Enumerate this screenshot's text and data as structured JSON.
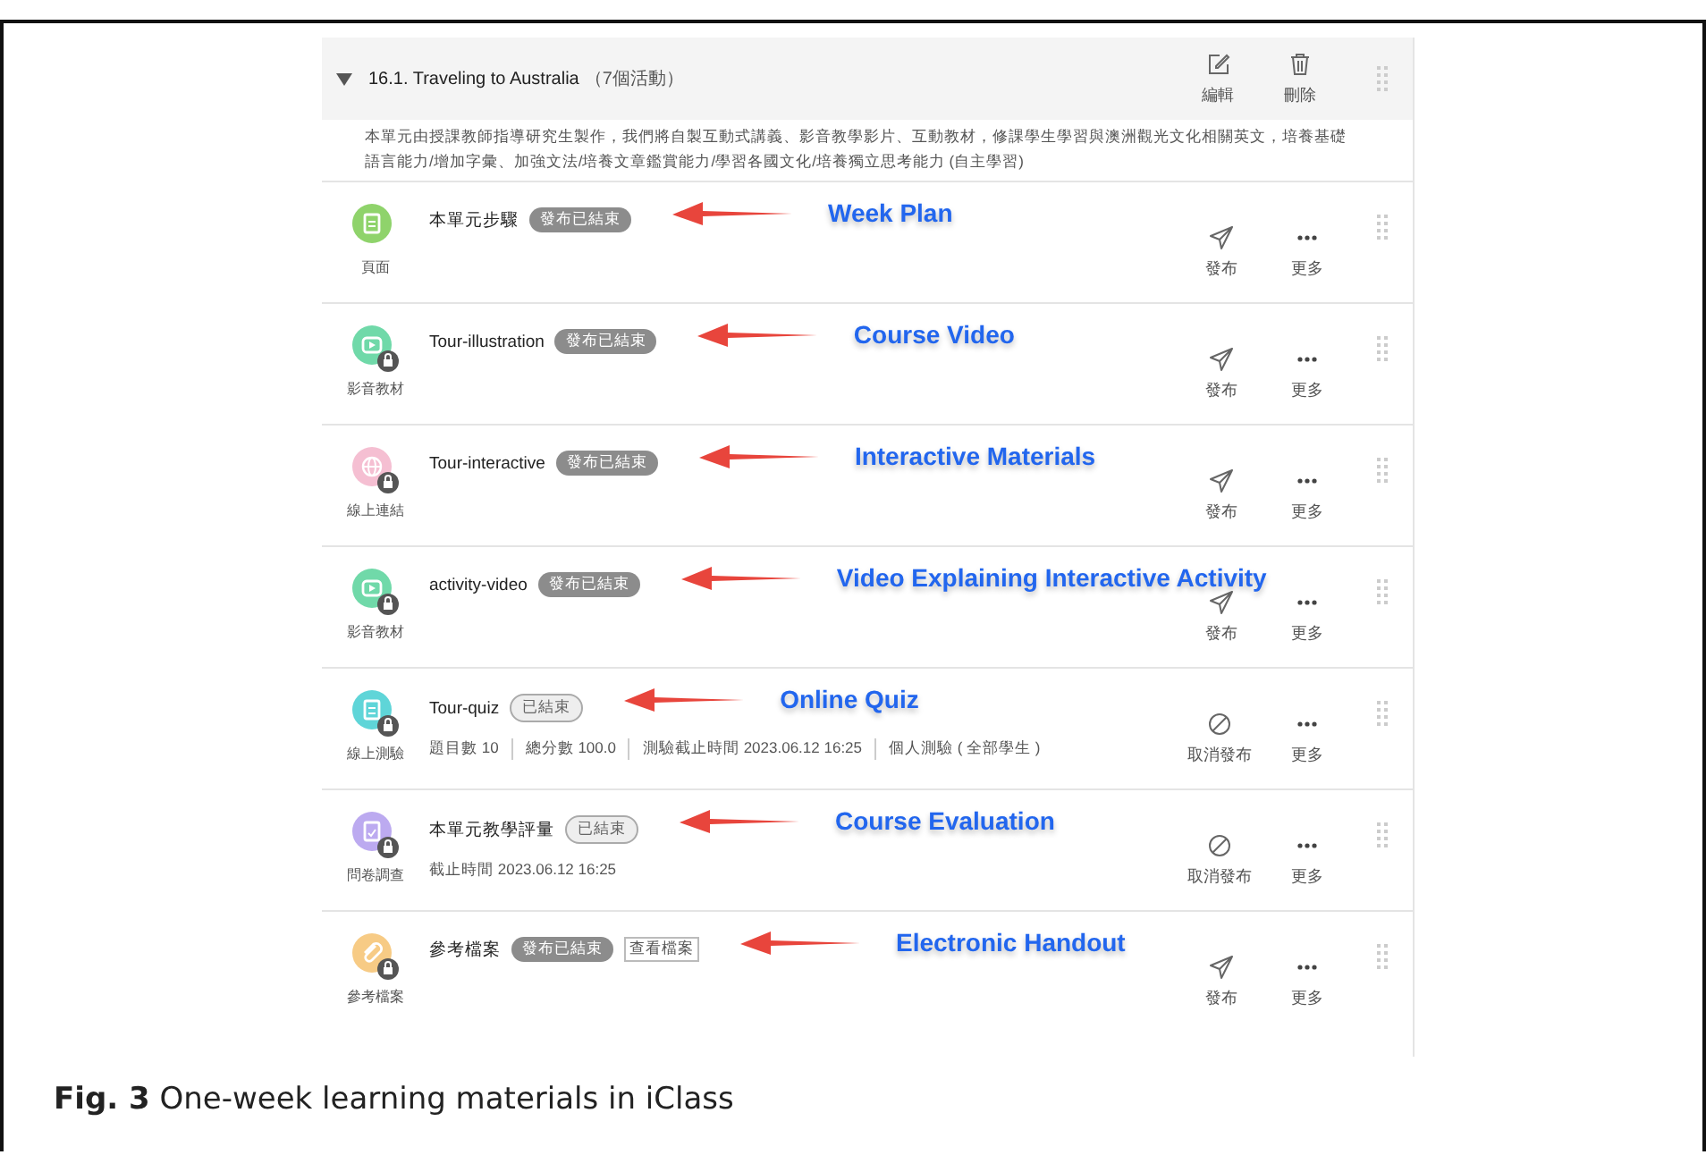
{
  "unit": {
    "expanded": true,
    "title": "16.1. Traveling to Australia",
    "count": "（7個活動）",
    "actions": [
      {
        "kind": "edit",
        "label": "編輯"
      },
      {
        "kind": "delete",
        "label": "刪除"
      }
    ],
    "description": "本單元由授課教師指導研究生製作，我們將自製互動式講義、影音教學影片、互動教材，修課學生學習與澳洲觀光文化相關英文，培養基礎語言能力/增加字彙、加強文法/培養文章鑑賞能力/學習各國文化/培養獨立思考能力 (自主學習)"
  },
  "activities": [
    {
      "kind": "page",
      "color": "#8fd36b",
      "locked": false,
      "type_label": "頁面",
      "title": "本單元步驟",
      "badge": {
        "kind": "release",
        "text": "發布已結束"
      },
      "action": {
        "kind": "publish",
        "label": "發布"
      },
      "more": "更多",
      "annotation": "Week Plan"
    },
    {
      "kind": "video",
      "color": "#70d9a9",
      "locked": true,
      "type_label": "影音教材",
      "title": "Tour-illustration",
      "badge": {
        "kind": "release",
        "text": "發布已結束"
      },
      "action": {
        "kind": "publish",
        "label": "發布"
      },
      "more": "更多",
      "annotation": "Course Video"
    },
    {
      "kind": "link",
      "color": "#f5bfd2",
      "locked": true,
      "type_label": "線上連結",
      "title": "Tour-interactive",
      "badge": {
        "kind": "release",
        "text": "發布已結束"
      },
      "action": {
        "kind": "publish",
        "label": "發布"
      },
      "more": "更多",
      "annotation": "Interactive Materials"
    },
    {
      "kind": "video",
      "color": "#70d9a9",
      "locked": true,
      "type_label": "影音教材",
      "title": "activity-video",
      "badge": {
        "kind": "release",
        "text": "發布已結束"
      },
      "action": {
        "kind": "publish",
        "label": "發布"
      },
      "more": "更多",
      "annotation": "Video Explaining Interactive Activity"
    },
    {
      "kind": "quiz",
      "color": "#5fd5d8",
      "locked": true,
      "type_label": "線上測驗",
      "title": "Tour-quiz",
      "badge": {
        "kind": "end",
        "text": "已結束"
      },
      "meta": [
        "題目數 10",
        "總分數 100.0",
        "測驗截止時間 2023.06.12 16:25",
        "個人測驗 ( 全部學生 )"
      ],
      "action": {
        "kind": "unpublish",
        "label": "取消發布"
      },
      "more": "更多",
      "annotation": "Online Quiz"
    },
    {
      "kind": "survey",
      "color": "#bcaaf0",
      "locked": true,
      "type_label": "問卷調查",
      "title": "本單元教學評量",
      "badge": {
        "kind": "end",
        "text": "已結束"
      },
      "meta": [
        "截止時間 2023.06.12 16:25"
      ],
      "action": {
        "kind": "unpublish",
        "label": "取消發布"
      },
      "more": "更多",
      "annotation": "Course Evaluation"
    },
    {
      "kind": "file",
      "color": "#f7cb85",
      "locked": true,
      "type_label": "參考檔案",
      "title": "參考檔案",
      "badge": {
        "kind": "release",
        "text": "發布已結束"
      },
      "link": "查看檔案",
      "action": {
        "kind": "publish",
        "label": "發布"
      },
      "more": "更多",
      "annotation": "Electronic Handout"
    }
  ],
  "caption": "**Fig. 3** One-week learning materials in iClass"
}
